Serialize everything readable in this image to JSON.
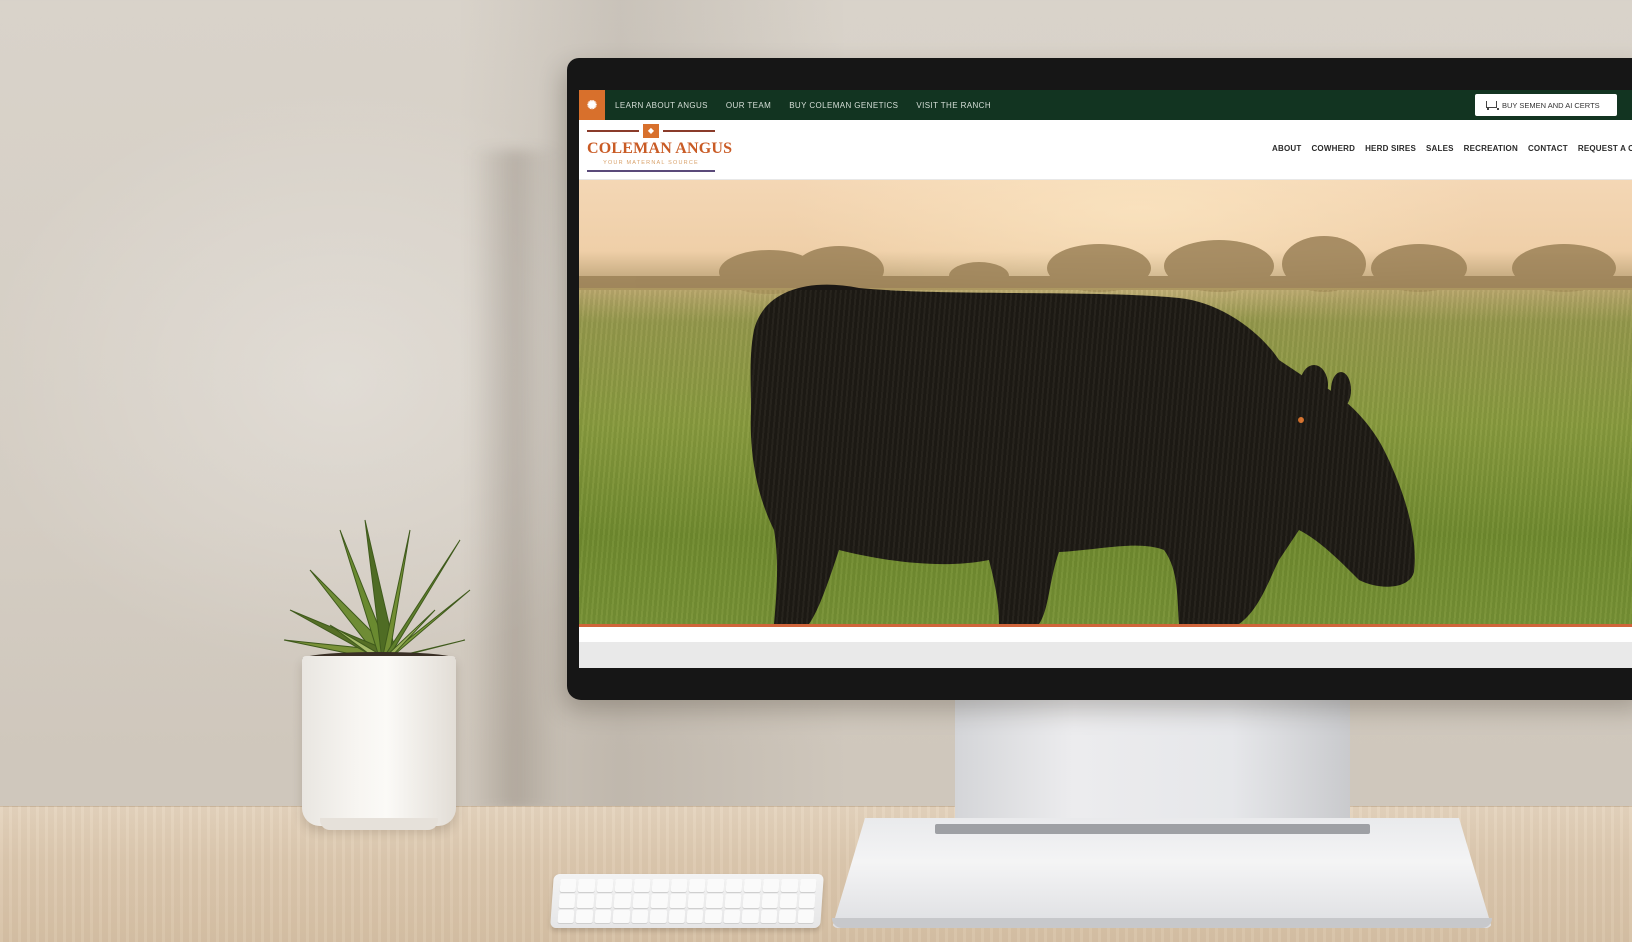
{
  "website": {
    "topbar": {
      "logo_icon": "ranch-emblem-icon",
      "links": [
        "LEARN ABOUT ANGUS",
        "OUR TEAM",
        "BUY COLEMAN GENETICS",
        "VISIT THE RANCH"
      ],
      "cart_button_label": "BUY SEMEN AND AI CERTS",
      "cart_icon": "cart-icon",
      "background_color": "#123421"
    },
    "brand": {
      "name": "COLEMAN ANGUS",
      "tagline": "YOUR MATERNAL SOURCE"
    },
    "mainnav": {
      "links": [
        "ABOUT",
        "COWHERD",
        "HERD SIRES",
        "SALES",
        "RECREATION",
        "CONTACT",
        "REQUEST A C"
      ]
    },
    "accent_color": "#c95b25"
  }
}
